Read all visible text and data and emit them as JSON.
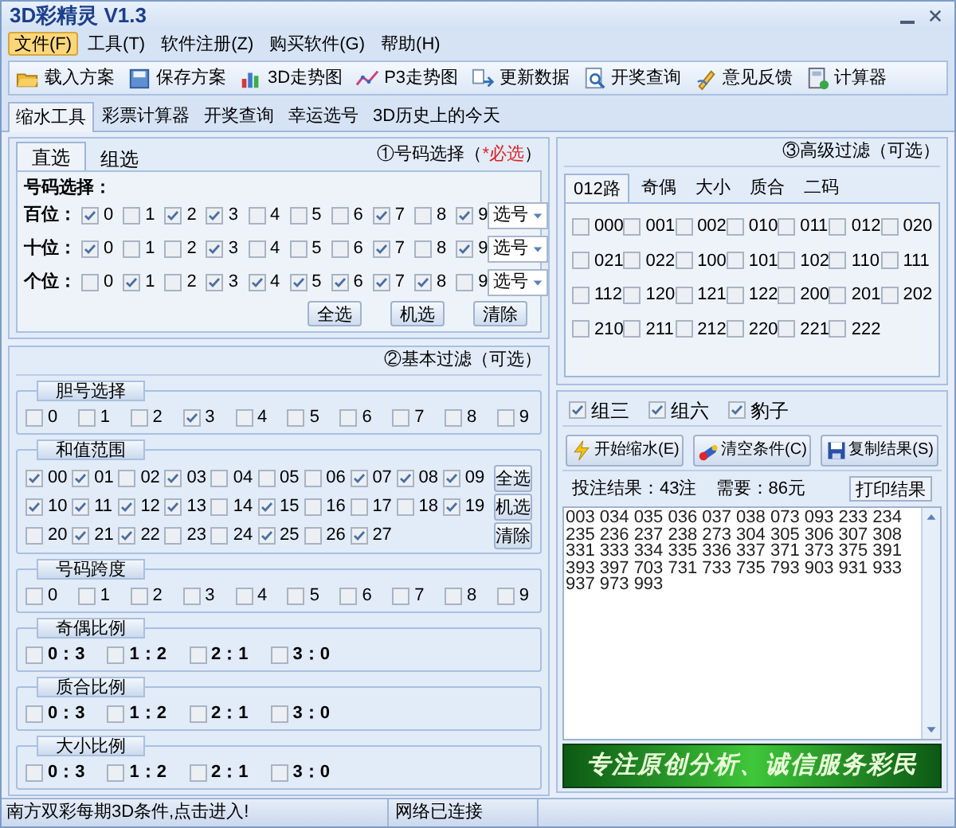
{
  "window": {
    "title": "3D彩精灵 V1.3"
  },
  "menu": [
    {
      "label": "文件(F)",
      "selected": true
    },
    {
      "label": "工具(T)",
      "selected": false
    },
    {
      "label": "软件注册(Z)",
      "selected": false
    },
    {
      "label": "购买软件(G)",
      "selected": false
    },
    {
      "label": "帮助(H)",
      "selected": false
    }
  ],
  "toolbar": [
    "载入方案",
    "保存方案",
    "3D走势图",
    "P3走势图",
    "更新数据",
    "开奖查询",
    "意见反馈",
    "计算器"
  ],
  "tabs": [
    {
      "label": "缩水工具",
      "selected": true
    },
    {
      "label": "彩票计算器",
      "selected": false
    },
    {
      "label": "开奖查询",
      "selected": false
    },
    {
      "label": "幸运选号",
      "selected": false
    },
    {
      "label": "3D历史上的今天",
      "selected": false
    }
  ],
  "number_selection": {
    "tabs": [
      {
        "label": "直选",
        "selected": true
      },
      {
        "label": "组选",
        "selected": false
      }
    ],
    "title": "①号码选择（",
    "required": "*必选",
    "title_end": "）",
    "label": "号码选择：",
    "rows": [
      {
        "label": "百位：",
        "dropdown": "选号",
        "digits": [
          {
            "label": "0",
            "checked": true
          },
          {
            "label": "1",
            "checked": false
          },
          {
            "label": "2",
            "checked": true
          },
          {
            "label": "3",
            "checked": true
          },
          {
            "label": "4",
            "checked": false
          },
          {
            "label": "5",
            "checked": false
          },
          {
            "label": "6",
            "checked": false
          },
          {
            "label": "7",
            "checked": true
          },
          {
            "label": "8",
            "checked": false
          },
          {
            "label": "9",
            "checked": true
          }
        ]
      },
      {
        "label": "十位：",
        "dropdown": "选号",
        "digits": [
          {
            "label": "0",
            "checked": true
          },
          {
            "label": "1",
            "checked": false
          },
          {
            "label": "2",
            "checked": false
          },
          {
            "label": "3",
            "checked": true
          },
          {
            "label": "4",
            "checked": false
          },
          {
            "label": "5",
            "checked": false
          },
          {
            "label": "6",
            "checked": false
          },
          {
            "label": "7",
            "checked": true
          },
          {
            "label": "8",
            "checked": false
          },
          {
            "label": "9",
            "checked": true
          }
        ]
      },
      {
        "label": "个位：",
        "dropdown": "选号",
        "digits": [
          {
            "label": "0",
            "checked": false
          },
          {
            "label": "1",
            "checked": true
          },
          {
            "label": "2",
            "checked": false
          },
          {
            "label": "3",
            "checked": true
          },
          {
            "label": "4",
            "checked": true
          },
          {
            "label": "5",
            "checked": true
          },
          {
            "label": "6",
            "checked": true
          },
          {
            "label": "7",
            "checked": true
          },
          {
            "label": "8",
            "checked": true
          },
          {
            "label": "9",
            "checked": false
          }
        ]
      }
    ],
    "buttons": [
      "全选",
      "机选",
      "清除"
    ]
  },
  "basic_filter": {
    "title": "②基本过滤（可选）",
    "groups": [
      {
        "title": "胆号选择",
        "kind": "digits",
        "options": [
          {
            "label": "0",
            "checked": false
          },
          {
            "label": "1",
            "checked": false
          },
          {
            "label": "2",
            "checked": false
          },
          {
            "label": "3",
            "checked": true
          },
          {
            "label": "4",
            "checked": false
          },
          {
            "label": "5",
            "checked": false
          },
          {
            "label": "6",
            "checked": false
          },
          {
            "label": "7",
            "checked": false
          },
          {
            "label": "8",
            "checked": false
          },
          {
            "label": "9",
            "checked": false
          }
        ]
      },
      {
        "title": "和值范围",
        "kind": "sum",
        "buttons": [
          "全选",
          "机选",
          "清除"
        ],
        "options": [
          {
            "label": "00",
            "checked": true
          },
          {
            "label": "01",
            "checked": true
          },
          {
            "label": "02",
            "checked": false
          },
          {
            "label": "03",
            "checked": true
          },
          {
            "label": "04",
            "checked": false
          },
          {
            "label": "05",
            "checked": false
          },
          {
            "label": "06",
            "checked": false
          },
          {
            "label": "07",
            "checked": true
          },
          {
            "label": "08",
            "checked": true
          },
          {
            "label": "09",
            "checked": true
          },
          {
            "label": "10",
            "checked": true
          },
          {
            "label": "11",
            "checked": true
          },
          {
            "label": "12",
            "checked": true
          },
          {
            "label": "13",
            "checked": true
          },
          {
            "label": "14",
            "checked": false
          },
          {
            "label": "15",
            "checked": true
          },
          {
            "label": "16",
            "checked": false
          },
          {
            "label": "17",
            "checked": false
          },
          {
            "label": "18",
            "checked": false
          },
          {
            "label": "19",
            "checked": true
          },
          {
            "label": "20",
            "checked": false
          },
          {
            "label": "21",
            "checked": true
          },
          {
            "label": "22",
            "checked": true
          },
          {
            "label": "23",
            "checked": false
          },
          {
            "label": "24",
            "checked": false
          },
          {
            "label": "25",
            "checked": true
          },
          {
            "label": "26",
            "checked": false
          },
          {
            "label": "27",
            "checked": true
          }
        ]
      },
      {
        "title": "号码跨度",
        "kind": "digits",
        "options": [
          {
            "label": "0",
            "checked": false
          },
          {
            "label": "1",
            "checked": false
          },
          {
            "label": "2",
            "checked": false
          },
          {
            "label": "3",
            "checked": false
          },
          {
            "label": "4",
            "checked": false
          },
          {
            "label": "5",
            "checked": false
          },
          {
            "label": "6",
            "checked": false
          },
          {
            "label": "7",
            "checked": false
          },
          {
            "label": "8",
            "checked": false
          },
          {
            "label": "9",
            "checked": false
          }
        ]
      },
      {
        "title": "奇偶比例",
        "kind": "ratio",
        "options": [
          {
            "label": "0：3",
            "checked": false
          },
          {
            "label": "1：2",
            "checked": false
          },
          {
            "label": "2：1",
            "checked": false
          },
          {
            "label": "3：0",
            "checked": false
          }
        ]
      },
      {
        "title": "质合比例",
        "kind": "ratio",
        "options": [
          {
            "label": "0：3",
            "checked": false
          },
          {
            "label": "1：2",
            "checked": false
          },
          {
            "label": "2：1",
            "checked": false
          },
          {
            "label": "3：0",
            "checked": false
          }
        ]
      },
      {
        "title": "大小比例",
        "kind": "ratio",
        "options": [
          {
            "label": "0：3",
            "checked": false
          },
          {
            "label": "1：2",
            "checked": false
          },
          {
            "label": "2：1",
            "checked": false
          },
          {
            "label": "3：0",
            "checked": false
          }
        ]
      }
    ]
  },
  "advanced_filter": {
    "title": "③高级过滤（可选）",
    "tabs": [
      {
        "label": "012路",
        "selected": true
      },
      {
        "label": "奇偶",
        "selected": false
      },
      {
        "label": "大小",
        "selected": false
      },
      {
        "label": "质合",
        "selected": false
      },
      {
        "label": "二码",
        "selected": false
      }
    ],
    "options": [
      {
        "label": "000",
        "checked": false
      },
      {
        "label": "001",
        "checked": false
      },
      {
        "label": "002",
        "checked": false
      },
      {
        "label": "010",
        "checked": false
      },
      {
        "label": "011",
        "checked": false
      },
      {
        "label": "012",
        "checked": false
      },
      {
        "label": "020",
        "checked": false
      },
      {
        "label": "021",
        "checked": false
      },
      {
        "label": "022",
        "checked": false
      },
      {
        "label": "100",
        "checked": false
      },
      {
        "label": "101",
        "checked": false
      },
      {
        "label": "102",
        "checked": false
      },
      {
        "label": "110",
        "checked": false
      },
      {
        "label": "111",
        "checked": false
      },
      {
        "label": "112",
        "checked": false
      },
      {
        "label": "120",
        "checked": false
      },
      {
        "label": "121",
        "checked": false
      },
      {
        "label": "122",
        "checked": false
      },
      {
        "label": "200",
        "checked": false
      },
      {
        "label": "201",
        "checked": false
      },
      {
        "label": "202",
        "checked": false
      },
      {
        "label": "210",
        "checked": false
      },
      {
        "label": "211",
        "checked": false
      },
      {
        "label": "212",
        "checked": false
      },
      {
        "label": "220",
        "checked": false
      },
      {
        "label": "221",
        "checked": false
      },
      {
        "label": "222",
        "checked": false
      }
    ]
  },
  "types": [
    {
      "label": "组三",
      "checked": true
    },
    {
      "label": "组六",
      "checked": true
    },
    {
      "label": "豹子",
      "checked": true
    }
  ],
  "actions": [
    "开始缩水(E)",
    "清空条件(C)",
    "复制结果(S)"
  ],
  "result": {
    "count": "投注结果：43注",
    "cost": "需要：86元",
    "print_button": "打印结果",
    "lines": [
      "003 034 035 036 037 038 073 093 233 234",
      "235 236 237 238 273 304 305 306 307 308",
      "331 333 334 335 336 337 371 373 375 391",
      "393 397 703 731 733 735 793 903 931 933",
      "937 973 993"
    ]
  },
  "banner": "专注原创分析、诚信服务彩民",
  "status_bar": [
    "南方双彩每期3D条件,点击进入!",
    "网络已连接"
  ]
}
